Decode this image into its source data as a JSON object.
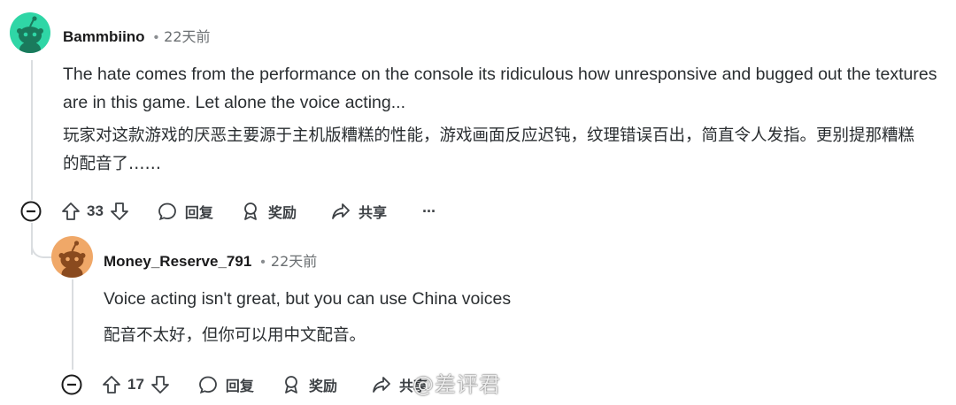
{
  "comments": [
    {
      "username": "Bammbiino",
      "age": "22天前",
      "text_en": "The hate comes from the performance on the console its ridiculous how unresponsive and bugged out the textures are in this game. Let alone the voice acting...",
      "text_zh": "玩家对这款游戏的厌恶主要源于主机版糟糕的性能，游戏画面反应迟钝，纹理错误百出，简直令人发指。更别提那糟糕的配音了……",
      "votes": "33",
      "reply_label": "回复",
      "award_label": "奖励",
      "share_label": "共享",
      "more_label": "···",
      "avatar_color": "#2fd6a6"
    },
    {
      "username": "Money_Reserve_791",
      "age": "22天前",
      "text_en": "Voice acting isn't great, but you can use China voices",
      "text_zh": "配音不太好，但你可以用中文配音。",
      "votes": "17",
      "reply_label": "回复",
      "award_label": "奖励",
      "share_label": "共享",
      "avatar_color": "#f0a868"
    }
  ],
  "watermark": "@差评君",
  "colors": {
    "text": "#1c1c1c",
    "muted": "#6b6f72",
    "line": "#dadde0"
  }
}
